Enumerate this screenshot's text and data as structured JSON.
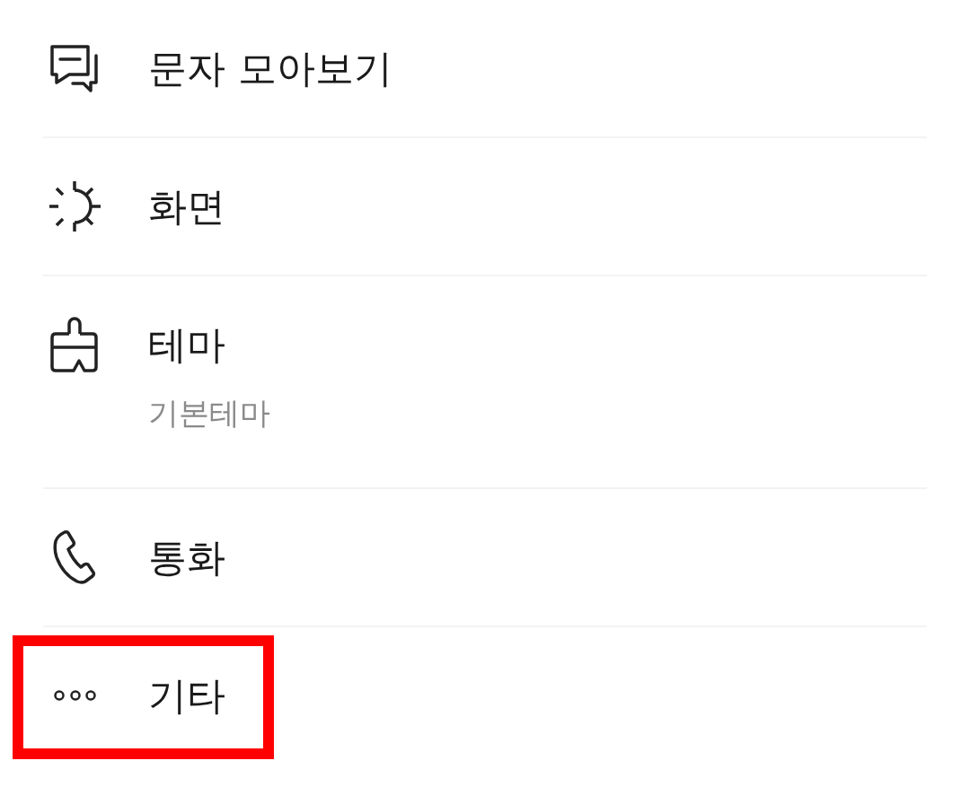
{
  "menu": {
    "items": [
      {
        "label": "문자 모아보기",
        "highlighted": false
      },
      {
        "label": "화면",
        "highlighted": false
      },
      {
        "label": "테마",
        "subtitle": "기본테마",
        "highlighted": false
      },
      {
        "label": "통화",
        "highlighted": false
      },
      {
        "label": "기타",
        "highlighted": true
      }
    ]
  }
}
